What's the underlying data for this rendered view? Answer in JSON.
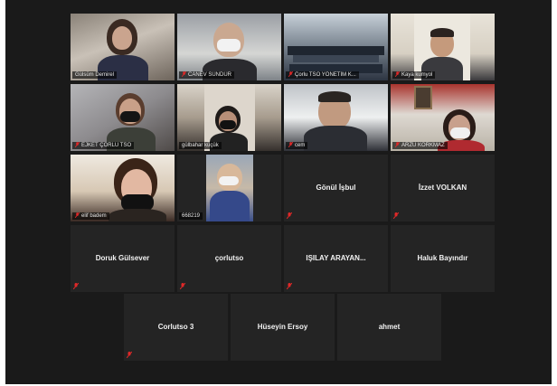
{
  "meeting": {
    "participants": [
      {
        "name": "Gülsüm Demirel",
        "video": true,
        "muted": false
      },
      {
        "name": "CANEV SÜNDÜR",
        "video": true,
        "muted": true
      },
      {
        "name": "Çorlu TSO YÖNETİM K...",
        "video": true,
        "muted": true
      },
      {
        "name": "Kaya kumyol",
        "video": true,
        "muted": true
      },
      {
        "name": "EJKET ÇORLU TSO",
        "video": true,
        "muted": true
      },
      {
        "name": "gülbahar küçük",
        "video": true,
        "muted": false,
        "active_speaker": true
      },
      {
        "name": "cem",
        "video": true,
        "muted": true
      },
      {
        "name": "ARZU KORKMAZ",
        "video": true,
        "muted": true
      },
      {
        "name": "elif badem",
        "video": true,
        "muted": true
      },
      {
        "name": "668219",
        "video": true,
        "muted": false
      },
      {
        "name": "Gönül İşbul",
        "video": false,
        "muted": true
      },
      {
        "name": "İzzet VOLKAN",
        "video": false,
        "muted": true
      },
      {
        "name": "Doruk Gülsever",
        "video": false,
        "muted": true
      },
      {
        "name": "çorlutso",
        "video": false,
        "muted": true
      },
      {
        "name": "IŞILAY ARAYAN...",
        "video": false,
        "muted": true
      },
      {
        "name": "Haluk Bayındır",
        "video": false,
        "muted": false
      },
      {
        "name": "Corlutso 3",
        "video": false,
        "muted": true
      },
      {
        "name": "Hüseyin Ersoy",
        "video": false,
        "muted": false
      },
      {
        "name": "ahmet",
        "video": false,
        "muted": false
      }
    ]
  },
  "icons": {
    "muted_mic": "mic-off-icon",
    "muted_color": "#e02828"
  },
  "colors": {
    "background": "#1a1a1a",
    "tile": "#242424",
    "active_speaker_border": "#b9c63a"
  }
}
